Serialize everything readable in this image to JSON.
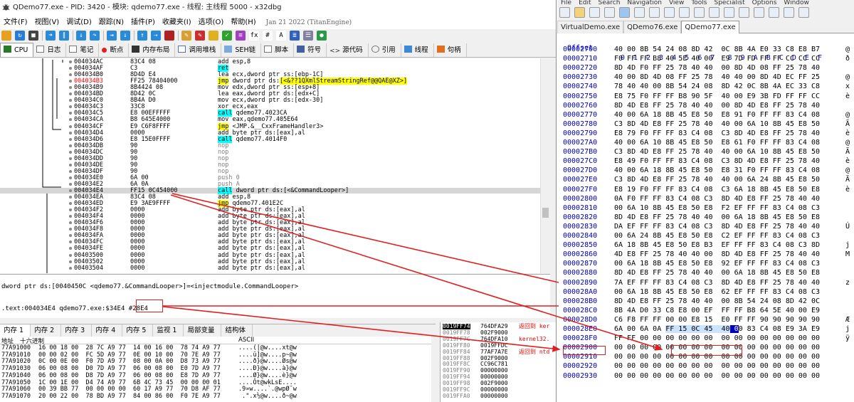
{
  "x32dbg": {
    "title": "QDemo77.exe - PID: 3420 - 模块: qdemo77.exe - 线程: 主线程 5000 - x32dbg",
    "menu": [
      "文件(F)",
      "视图(V)",
      "调试(D)",
      "跟踪(N)",
      "插件(P)",
      "收藏夹(I)",
      "选项(O)",
      "帮助(H)"
    ],
    "build_date": "Jan 21 2022 (TitanEngine)",
    "tabs": [
      "CPU",
      "日志",
      "笔记",
      "断点",
      "内存布局",
      "调用堆栈",
      "SEH链",
      "脚本",
      "符号",
      "源代码",
      "引用",
      "线程",
      "句柄"
    ],
    "disasm": [
      {
        "addr": "004034AC",
        "bytes": "83C4 08",
        "ins": "add esp,8"
      },
      {
        "addr": "004034AF",
        "bytes": "C3",
        "ins": "ret",
        "hl": "ret"
      },
      {
        "addr": "004034B0",
        "bytes": "8D4D E4",
        "ins": "lea ecx,dword ptr ss:[ebp-1C]"
      },
      {
        "addr": "004034B3",
        "bytes": "FF25 78404000",
        "ins": "jmp dword ptr ds:[<&??1QXmlStreamStringRef@@QAE@XZ>]",
        "hl": "jmp",
        "red": true
      },
      {
        "addr": "004034B9",
        "bytes": "8B4424 08",
        "ins": "mov edx,dword ptr ss:[esp+8]"
      },
      {
        "addr": "004034BD",
        "bytes": "8D42 0C",
        "ins": "lea eax,dword ptr ds:[edx+C]"
      },
      {
        "addr": "004034C0",
        "bytes": "8B4A D0",
        "ins": "mov ecx,dword ptr ds:[edx-30]"
      },
      {
        "addr": "004034C3",
        "bytes": "33C8",
        "ins": "xor ecx,eax"
      },
      {
        "addr": "004034C5",
        "bytes": "E8 00EFFFFF",
        "ins": "call qdemo77.4023CA",
        "hl": "call"
      },
      {
        "addr": "004034CA",
        "bytes": "B8 645E4000",
        "ins": "mov eax,qdemo77.405E64"
      },
      {
        "addr": "004034CF",
        "bytes": "E9 C6F8FFFF",
        "ins": "jmp <JMP.&__CxxFrameHandler3>",
        "hl": "jmp"
      },
      {
        "addr": "004034D4",
        "bytes": "0000",
        "ins": "add byte ptr ds:[eax],al"
      },
      {
        "addr": "004034D6",
        "bytes": "E8 15E0FFFF",
        "ins": "call qdemo77.4014F0",
        "hl": "call"
      },
      {
        "addr": "004034DB",
        "bytes": "90",
        "ins": "nop",
        "gray": true
      },
      {
        "addr": "004034DC",
        "bytes": "90",
        "ins": "nop",
        "gray": true
      },
      {
        "addr": "004034DD",
        "bytes": "90",
        "ins": "nop",
        "gray": true
      },
      {
        "addr": "004034DE",
        "bytes": "90",
        "ins": "nop",
        "gray": true
      },
      {
        "addr": "004034DF",
        "bytes": "90",
        "ins": "nop",
        "gray": true
      },
      {
        "addr": "004034E0",
        "bytes": "6A 00",
        "ins": "push 0",
        "gray": true
      },
      {
        "addr": "004034E2",
        "bytes": "6A 0A",
        "ins": "push A",
        "gray": true
      },
      {
        "addr": "004034E4",
        "bytes": "FF15 0C454000",
        "ins": "call dword ptr ds:[<&CommandLooper>]",
        "hl": "call",
        "cur": true
      },
      {
        "addr": "004034EA",
        "bytes": "83C4 08",
        "ins": "add esp,8"
      },
      {
        "addr": "004034ED",
        "bytes": "E9 3AE9FFFF",
        "ins": "jmp qdemo77.401E2C",
        "hl": "jmp"
      },
      {
        "addr": "004034F2",
        "bytes": "0000",
        "ins": "add byte ptr ds:[eax],al"
      },
      {
        "addr": "004034F4",
        "bytes": "0000",
        "ins": "add byte ptr ds:[eax],al"
      },
      {
        "addr": "004034F6",
        "bytes": "0000",
        "ins": "add byte ptr ds:[eax],al"
      },
      {
        "addr": "004034F8",
        "bytes": "0000",
        "ins": "add byte ptr ds:[eax],al"
      },
      {
        "addr": "004034FA",
        "bytes": "0000",
        "ins": "add byte ptr ds:[eax],al"
      },
      {
        "addr": "004034FC",
        "bytes": "0000",
        "ins": "add byte ptr ds:[eax],al"
      },
      {
        "addr": "004034FE",
        "bytes": "0000",
        "ins": "add byte ptr ds:[eax],al"
      },
      {
        "addr": "00403500",
        "bytes": "0000",
        "ins": "add byte ptr ds:[eax],al"
      },
      {
        "addr": "00403502",
        "bytes": "0000",
        "ins": "add byte ptr ds:[eax],al"
      },
      {
        "addr": "00403504",
        "bytes": "0000",
        "ins": "add byte ptr ds:[eax],al"
      }
    ],
    "info_line1": "dword ptr ds:[0040450C <qdemo77.&CommandLooper>]=<injectmodule.CommandLooper>",
    "info_line2": ".text:004034E4 qdemo77.exe:$34E4 #28E4",
    "bottom_tabs": [
      "内存 1",
      "内存 2",
      "内存 3",
      "内存 4",
      "内存 5",
      "监视 1",
      "局部变量",
      "结构体"
    ],
    "dump_header": [
      "地址",
      "十六进制",
      "ASCII"
    ],
    "dump": [
      {
        "a": "77A91000",
        "h": "16 00 18 00  28 7C A9 77  14 00 16 00  78 74 A9 77",
        "x": "....(|@w....xt@w"
      },
      {
        "a": "77A91010",
        "h": "00 00 02 00  FC 5D A9 77  0E 00 10 00  70 7E A9 77",
        "x": "....ü]@w....p~@w"
      },
      {
        "a": "77A91020",
        "h": "0C 00 0E 00  F0 7D A9 77  08 00 0A 00  D8 73 A9 77",
        "x": "....ð}@w....Øs@w"
      },
      {
        "a": "77A91030",
        "h": "06 00 08 00  D0 7D A9 77  06 00 08 00  E0 7D A9 77",
        "x": "....Ð}@w....à}@w"
      },
      {
        "a": "77A91040",
        "h": "06 00 08 00  D8 7D A9 77  06 00 08 00  E8 7D A9 77",
        "x": "....Ø}@w....è}@w"
      },
      {
        "a": "77A91050",
        "h": "1C 00 1E 00  D4 74 A9 77  6B 4C 73 45  00 00 00 01",
        "x": "....Ôt@wkLsE...."
      },
      {
        "a": "77A91060",
        "h": "00 39 BB 77  00 00 00 00  60 17 A9 77  70 D8 AF 77",
        "x": ".9»w....`.@wpØ¯w"
      },
      {
        "a": "77A91070",
        "h": "20 00 22 00  78 BD A9 77  84 00 86 00  F0 7E A9 77",
        "x": " .\".x½@w....ð~@w"
      }
    ],
    "stack": [
      {
        "a": "0019FF74",
        "v": "764DFA29",
        "c": "返回到 ker"
      },
      {
        "a": "0019FF78",
        "v": "002F9000",
        "c": ""
      },
      {
        "a": "0019FF7C",
        "v": "764DFA10",
        "c": "kernel32."
      },
      {
        "a": "0019FF80",
        "v": "0019FFDC",
        "c": ""
      },
      {
        "a": "0019FF84",
        "v": "77AF7A7E",
        "c": "返回到 ntd"
      },
      {
        "a": "0019FF88",
        "v": "002F9000",
        "c": ""
      },
      {
        "a": "0019FF8C",
        "v": "CC96C781",
        "c": ""
      },
      {
        "a": "0019FF90",
        "v": "00000000",
        "c": ""
      },
      {
        "a": "0019FF94",
        "v": "00000000",
        "c": ""
      },
      {
        "a": "0019FF98",
        "v": "002F9000",
        "c": ""
      },
      {
        "a": "0019FF9C",
        "v": "00000000",
        "c": ""
      },
      {
        "a": "0019FFA0",
        "v": "00000000",
        "c": ""
      }
    ]
  },
  "hxd": {
    "menu": [
      "File",
      "Edit",
      "Search",
      "Navigation",
      "View",
      "Tools",
      "Specialist",
      "Options",
      "Window"
    ],
    "tabs": [
      "VirtualDemo.exe",
      "QDemo76.exe",
      "QDemo77.exe"
    ],
    "header_offset": "Offset",
    "header_cols": "0  1  2  3  4  5  6  7   8  9  A  B  C  D  E  F",
    "rows": [
      {
        "o": "00002700",
        "b": "40 00 8B 54 24 08 8D 42  0C 8B 4A E0 33 C8 E8 B7",
        "c": "@"
      },
      {
        "o": "00002710",
        "b": "F0 FF FF B8 40 5E 40 00  E9 7D FD FF FF CC CC CC",
        "c": "ð"
      },
      {
        "o": "00002720",
        "b": "8D 4D F0 FF 25 78 40 40  00 8D 4D 08 FF 25 78 40",
        "c": ""
      },
      {
        "o": "00002730",
        "b": "40 00 8D 4D 08 FF 25 78  40 40 00 8D 4D EC FF 25",
        "c": "@"
      },
      {
        "o": "00002740",
        "b": "78 40 40 00 8B 54 24 08  8D 42 0C 8B 4A EC 33 C8",
        "c": "x"
      },
      {
        "o": "00002750",
        "b": "E8 75 F0 FF FF B8 90 5F  40 00 E9 3B FD FF FF CC",
        "c": "è"
      },
      {
        "o": "00002760",
        "b": "8D 4D E8 FF 25 78 40 40  00 8D 4D E8 FF 25 78 40",
        "c": ""
      },
      {
        "o": "00002770",
        "b": "40 00 6A 18 8B 45 E8 50  E8 91 F0 FF FF 83 C4 08",
        "c": "@"
      },
      {
        "o": "00002780",
        "b": "C3 8D 4D E8 FF 25 78 40  40 00 6A 10 8B 45 E8 50",
        "c": "Ã"
      },
      {
        "o": "00002790",
        "b": "E8 79 F0 FF FF 83 C4 08  C3 8D 4D E8 FF 25 78 40",
        "c": "è"
      },
      {
        "o": "000027A0",
        "b": "40 00 6A 10 8B 45 E8 50  E8 61 F0 FF FF 83 C4 08",
        "c": "@"
      },
      {
        "o": "000027B0",
        "b": "C3 8D 4D E8 FF 25 78 40  40 00 6A 10 8B 45 E8 50",
        "c": "Ã"
      },
      {
        "o": "000027C0",
        "b": "E8 49 F0 FF FF 83 C4 08  C3 8D 4D E8 FF 25 78 40",
        "c": "è"
      },
      {
        "o": "000027D0",
        "b": "40 00 6A 18 8B 45 E8 50  E8 31 F0 FF FF 83 C4 08",
        "c": "@"
      },
      {
        "o": "000027E0",
        "b": "C3 8D 4D E8 FF 25 78 40  40 00 6A 24 8B 45 E8 50",
        "c": "Ã"
      },
      {
        "o": "000027F0",
        "b": "E8 19 F0 FF FF 83 C4 08  C3 6A 18 8B 45 E8 50 E8",
        "c": "è"
      },
      {
        "o": "00002800",
        "b": "0A F0 FF FF 83 C4 08 C3  8D 4D E8 FF 25 78 40 40",
        "c": ""
      },
      {
        "o": "00002810",
        "b": "00 6A 10 8B 45 E8 50 E8  F2 EF FF FF 83 C4 08 C3",
        "c": ""
      },
      {
        "o": "00002820",
        "b": "8D 4D E8 FF 25 78 40 40  00 6A 18 8B 45 E8 50 E8",
        "c": ""
      },
      {
        "o": "00002830",
        "b": "DA EF FF FF 83 C4 08 C3  8D 4D E8 FF 25 78 40 40",
        "c": "Ú"
      },
      {
        "o": "00002840",
        "b": "00 6A 24 8B 45 E8 50 E8  C2 EF FF FF 83 C4 08 C3",
        "c": ""
      },
      {
        "o": "00002850",
        "b": "6A 18 8B 45 E8 50 E8 B3  EF FF FF 83 C4 08 C3 8D",
        "c": "j"
      },
      {
        "o": "00002860",
        "b": "4D E8 FF 25 78 40 40 00  8D 4D E8 FF 25 78 40 40",
        "c": "M"
      },
      {
        "o": "00002870",
        "b": "00 6A 18 8B 45 E8 50 E8  92 EF FF FF 83 C4 08 C3",
        "c": ""
      },
      {
        "o": "00002880",
        "b": "8D 4D E8 FF 25 78 40 40  00 6A 18 8B 45 E8 50 E8",
        "c": ""
      },
      {
        "o": "00002890",
        "b": "7A EF FF FF 83 C4 08 C3  8D 4D E8 FF 25 78 40 40",
        "c": "z"
      },
      {
        "o": "000028A0",
        "b": "00 6A 18 8B 45 E8 50 E8  62 EF FF FF 83 C4 08 C3",
        "c": ""
      },
      {
        "o": "000028B0",
        "b": "8D 4D E8 FF 25 78 40 40  00 8B 54 24 08 8D 42 0C",
        "c": ""
      },
      {
        "o": "000028C0",
        "b": "8B 4A D0 33 C8 E8 00 EF  FF FF B8 64 5E 40 00 E9",
        "c": ""
      },
      {
        "o": "000028D0",
        "b": "C6 F8 FF FF 00 00 E8 15  E0 FF FF 90 90 90 90 90",
        "c": "Æ"
      },
      {
        "o": "000028E0",
        "b": "6A 00 6A 0A FF 15 0C 45  40 00 83 C4 08 E9 3A E9",
        "c": "j"
      },
      {
        "o": "000028F0",
        "b": "FF FF 00 00 00 00 00 00  00 00 00 00 00 00 00 00",
        "c": "ÿ"
      },
      {
        "o": "00002900",
        "b": "00 00 00 00 00 00 00 00  00 00 00 00 00 00 00 00",
        "c": ""
      },
      {
        "o": "00002910",
        "b": "00 00 00 00 00 00 00 00  00 00 00 00 00 00 00 00",
        "c": ""
      },
      {
        "o": "00002920",
        "b": "00 00 00 00 00 00 00 00  00 00 00 00 00 00 00 00",
        "c": ""
      },
      {
        "o": "00002930",
        "b": "00 00 00 00 00 00 00 00  00 00 00 00 00 00 00 00",
        "c": ""
      }
    ]
  }
}
